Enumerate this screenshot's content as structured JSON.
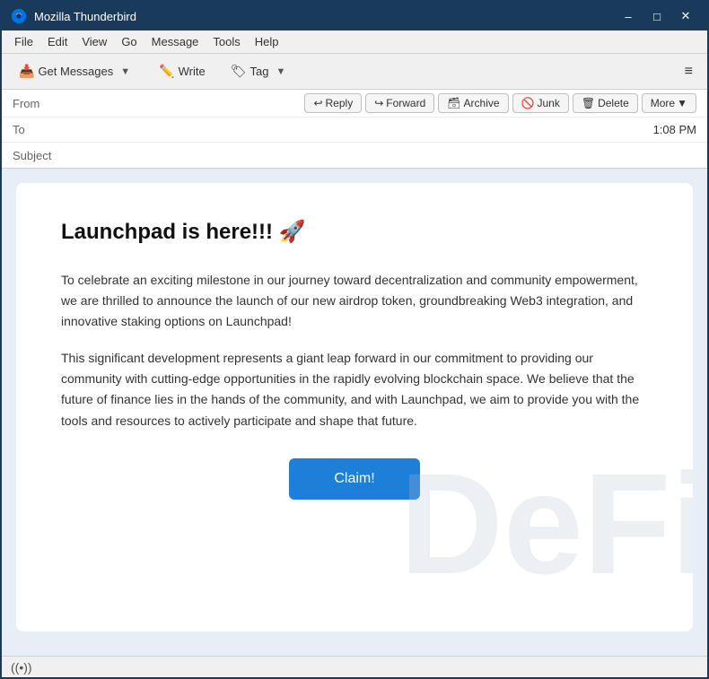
{
  "window": {
    "title": "Mozilla Thunderbird",
    "minimize_label": "–",
    "maximize_label": "□",
    "close_label": "✕"
  },
  "menubar": {
    "items": [
      "File",
      "Edit",
      "View",
      "Go",
      "Message",
      "Tools",
      "Help"
    ]
  },
  "toolbar": {
    "get_messages_label": "Get Messages",
    "write_label": "Write",
    "tag_label": "Tag",
    "hamburger_label": "≡"
  },
  "email_actions": {
    "reply_label": "Reply",
    "forward_label": "Forward",
    "archive_label": "Archive",
    "junk_label": "Junk",
    "delete_label": "Delete",
    "more_label": "More"
  },
  "email_headers": {
    "from_label": "From",
    "to_label": "To",
    "subject_label": "Subject",
    "time": "1:08 PM"
  },
  "email_content": {
    "title": "Launchpad is here!!! 🚀",
    "paragraph1": "To celebrate an exciting milestone in our journey toward decentralization and community empowerment, we are thrilled to announce the launch of our new airdrop token, groundbreaking Web3 integration, and innovative staking options on Launchpad!",
    "paragraph2": "This significant development represents a giant leap forward in our commitment to providing our community with cutting-edge opportunities in the rapidly evolving blockchain space. We believe that the future of finance lies in the hands of the community, and with Launchpad, we aim to provide you with the tools and resources to actively participate and shape that future.",
    "claim_label": "Claim!",
    "watermark": "DeFi"
  },
  "statusbar": {
    "icon": "((•))",
    "text": ""
  }
}
